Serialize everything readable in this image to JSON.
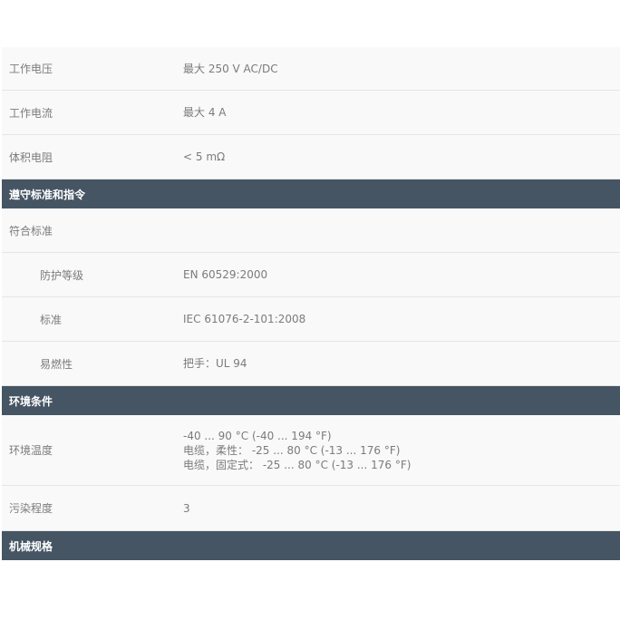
{
  "spec_rows_top": [
    {
      "label": "工作电压",
      "value": "最大 250 V AC/DC"
    },
    {
      "label": "工作电流",
      "value": "最大 4 A"
    },
    {
      "label": "体积电阻",
      "value": "< 5 mΩ"
    }
  ],
  "sections": {
    "standards": {
      "title": "遵守标准和指令",
      "group_label": "符合标准",
      "items": [
        {
          "label": "防护等级",
          "value": "EN 60529:2000"
        },
        {
          "label": "标准",
          "value": "IEC 61076-2-101:2008"
        },
        {
          "label": "易燃性",
          "value": "把手：UL 94"
        }
      ]
    },
    "environment": {
      "title": "环境条件",
      "temperature_label": "环境温度",
      "temperature_values": [
        "-40 ... 90 °C (-40 ... 194 °F)",
        "电缆，柔性： -25 ... 80 °C (-13 ... 176 °F)",
        "电缆，固定式： -25 ... 80 °C (-13 ... 176 °F)"
      ],
      "pollution_label": "污染程度",
      "pollution_value": "3"
    },
    "mechanical": {
      "title": "机械规格"
    }
  },
  "colors": {
    "section_header_bg": "#455563",
    "row_bg": "#f9f9f9",
    "text": "#7b7b7b"
  }
}
